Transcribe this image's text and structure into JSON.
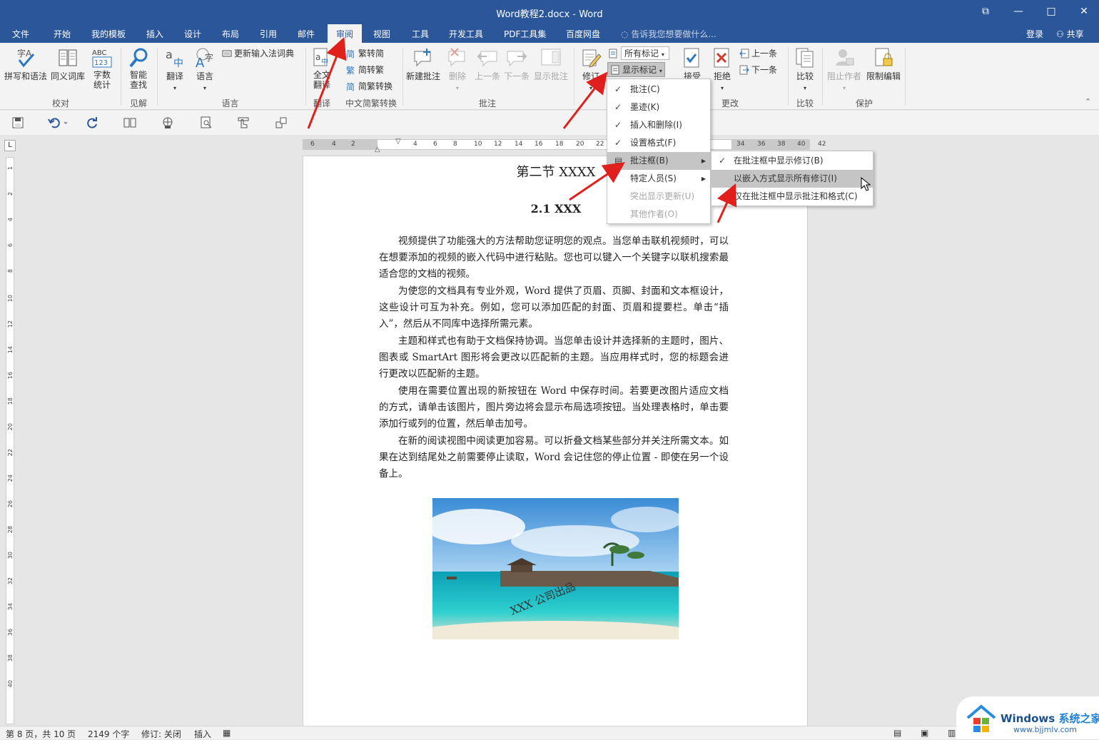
{
  "window": {
    "title": "Word教程2.docx - Word",
    "controls": {
      "restore": "⧉",
      "minimize": "—",
      "maximize": "□",
      "close": "✕"
    }
  },
  "tabs": [
    {
      "label": "文件"
    },
    {
      "label": "开始"
    },
    {
      "label": "我的模板"
    },
    {
      "label": "插入"
    },
    {
      "label": "设计"
    },
    {
      "label": "布局"
    },
    {
      "label": "引用"
    },
    {
      "label": "邮件"
    },
    {
      "label": "审阅",
      "active": true
    },
    {
      "label": "视图"
    },
    {
      "label": "工具"
    },
    {
      "label": "开发工具"
    },
    {
      "label": "PDF工具集"
    },
    {
      "label": "百度网盘"
    }
  ],
  "tellme": "告诉我您想要做什么...",
  "account": {
    "login": "登录",
    "share": "共享"
  },
  "ribbon": {
    "spelling": "拼写和语法",
    "thesaurus": "同义词库",
    "wordcount_1": "字数",
    "wordcount_2": "统计",
    "smart_lookup_1": "智能",
    "smart_lookup_2": "查找",
    "translate": "翻译",
    "language": "语言",
    "update_ime": "更新输入法词典",
    "full_translate_1": "全文",
    "full_translate_2": "翻译",
    "trad_to_simp": "繁转简",
    "simp_to_trad": "简转繁",
    "convert": "简繁转换",
    "new_comment": "新建批注",
    "delete": "删除",
    "previous": "上一条",
    "next": "下一条",
    "show_comments": "显示批注",
    "track_changes": "修订",
    "markup_select": "所有标记",
    "show_markup": "显示标记",
    "accept": "接受",
    "reject": "拒绝",
    "prev_change": "上一条",
    "next_change": "下一条",
    "compare": "比较",
    "block_authors": "阻止作者",
    "restrict_editing": "限制编辑",
    "groups": {
      "proofing": "校对",
      "insights": "见解",
      "language": "语言",
      "translate": "翻译",
      "chinese_conversion": "中文简繁转换",
      "comments": "批注",
      "changes": "更改",
      "compare": "比较",
      "protect": "保护"
    }
  },
  "ruler": {
    "h": [
      "6",
      "4",
      "2",
      "2",
      "4",
      "6",
      "8",
      "10",
      "12",
      "14",
      "16",
      "18",
      "20",
      "22",
      "34",
      "36",
      "38",
      "40",
      "42"
    ],
    "v": [
      "1",
      "2",
      "4",
      "6",
      "8",
      "10",
      "12",
      "14",
      "16",
      "18",
      "20",
      "22",
      "24",
      "26",
      "28",
      "30",
      "32",
      "34",
      "36",
      "38",
      "40"
    ]
  },
  "document": {
    "heading1": "第二节  XXXX",
    "heading2": "2.1 XXX",
    "paragraphs": [
      "视频提供了功能强大的方法帮助您证明您的观点。当您单击联机视频时，可以在想要添加的视频的嵌入代码中进行粘贴。您也可以键入一个关键字以联机搜索最适合您的文档的视频。",
      "为使您的文档具有专业外观，Word 提供了页眉、页脚、封面和文本框设计，这些设计可互为补充。例如，您可以添加匹配的封面、页眉和提要栏。单击“插入”，然后从不同库中选择所需元素。",
      "主题和样式也有助于文档保持协调。当您单击设计并选择新的主题时，图片、图表或 SmartArt 图形将会更改以匹配新的主题。当应用样式时，您的标题会进行更改以匹配新的主题。",
      "使用在需要位置出现的新按钮在 Word 中保存时间。若要更改图片适应文档的方式，请单击该图片，图片旁边将会显示布局选项按钮。当处理表格时，单击要添加行或列的位置，然后单击加号。",
      "在新的阅读视图中阅读更加容易。可以折叠文档某些部分并关注所需文本。如果在达到结尾处之前需要停止读取，Word 会记住您的停止位置 - 即使在另一个设备上。"
    ],
    "watermark_text": "XXX 公司出品"
  },
  "menu_markup": [
    {
      "label": "批注(C)",
      "checked": true,
      "enabled": true
    },
    {
      "label": "墨迹(K)",
      "checked": true,
      "enabled": true
    },
    {
      "label": "插入和删除(I)",
      "checked": true,
      "enabled": true
    },
    {
      "label": "设置格式(F)",
      "checked": true,
      "enabled": true
    },
    {
      "label": "批注框(B)",
      "checked": false,
      "enabled": true,
      "submenu": true,
      "highlighted": true
    },
    {
      "label": "特定人员(S)",
      "checked": false,
      "enabled": true,
      "submenu": true
    },
    {
      "label": "突出显示更新(U)",
      "checked": false,
      "enabled": false
    },
    {
      "label": "其他作者(O)",
      "checked": false,
      "enabled": false
    }
  ],
  "menu_balloons": [
    {
      "label": "在批注框中显示修订(B)",
      "checked": true
    },
    {
      "label": "以嵌入方式显示所有修订(I)",
      "checked": false,
      "highlighted": true
    },
    {
      "label": "仅在批注框中显示批注和格式(C)",
      "checked": false
    }
  ],
  "status": {
    "page": "第 8 页，共 10 页",
    "words": "2149 个字",
    "track": "修订: 关闭",
    "mode": "插入"
  },
  "site_watermark": {
    "brand": "Windows",
    "brand2": "系统之家",
    "url": "www.bjjmlv.com"
  },
  "colors": {
    "accent": "#2b579a",
    "arrow": "#e0201c",
    "highlight": "#c5c5c5"
  }
}
